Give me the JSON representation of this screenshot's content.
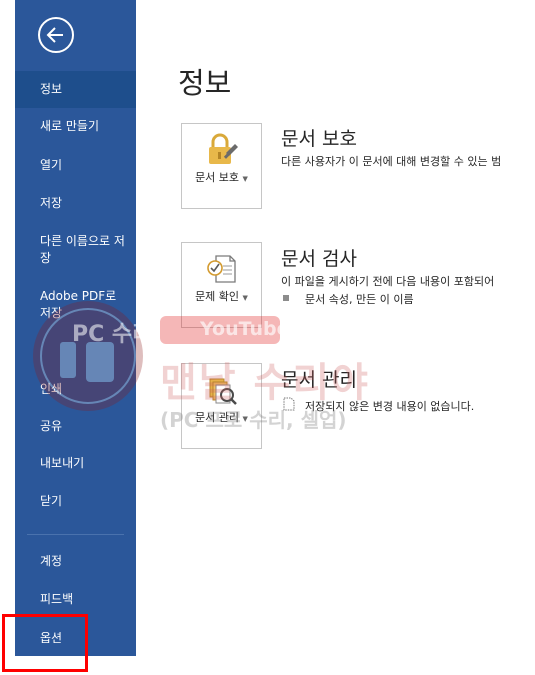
{
  "sidebar": {
    "items": [
      {
        "label": "정보",
        "selected": true
      },
      {
        "label": "새로 만들기"
      },
      {
        "label": "열기"
      },
      {
        "label": "저장"
      },
      {
        "label": "다른 이름으로 저장"
      },
      {
        "label": "Adobe PDF로 저장"
      },
      {
        "label": "인쇄"
      },
      {
        "label": "공유"
      },
      {
        "label": "내보내기"
      },
      {
        "label": "닫기"
      },
      {
        "label": "계정"
      },
      {
        "label": "피드백"
      },
      {
        "label": "옵션"
      }
    ],
    "back_icon": "arrow-left-icon",
    "colors": {
      "background": "#2b579a",
      "selected": "#1e4e8c"
    }
  },
  "main": {
    "title": "정보",
    "sections": [
      {
        "button_label": "문서 보호",
        "icon": "lock-icon",
        "title": "문서 보호",
        "description": "다른 사용자가 이 문서에 대해 변경할 수 있는 범"
      },
      {
        "button_label": "문제 확인",
        "icon": "inspect-document-icon",
        "title": "문서 검사",
        "description": "이 파일을 게시하기 전에 다음 내용이 포함되어",
        "bullets": [
          "문서 속성, 만든 이 이름"
        ]
      },
      {
        "button_label": "문서 관리",
        "icon": "manage-document-icon",
        "title": "문서 관리",
        "description": "저장되지 않은 변경 내용이 없습니다."
      }
    ]
  },
  "watermark": {
    "badge": "PC 수리인",
    "youtube": "YouTube",
    "name": "맨날 수리야",
    "subtitle": "(PC 프로 수리, 셀업)"
  },
  "highlight": {
    "color": "#ff0000",
    "target": "옵션"
  }
}
